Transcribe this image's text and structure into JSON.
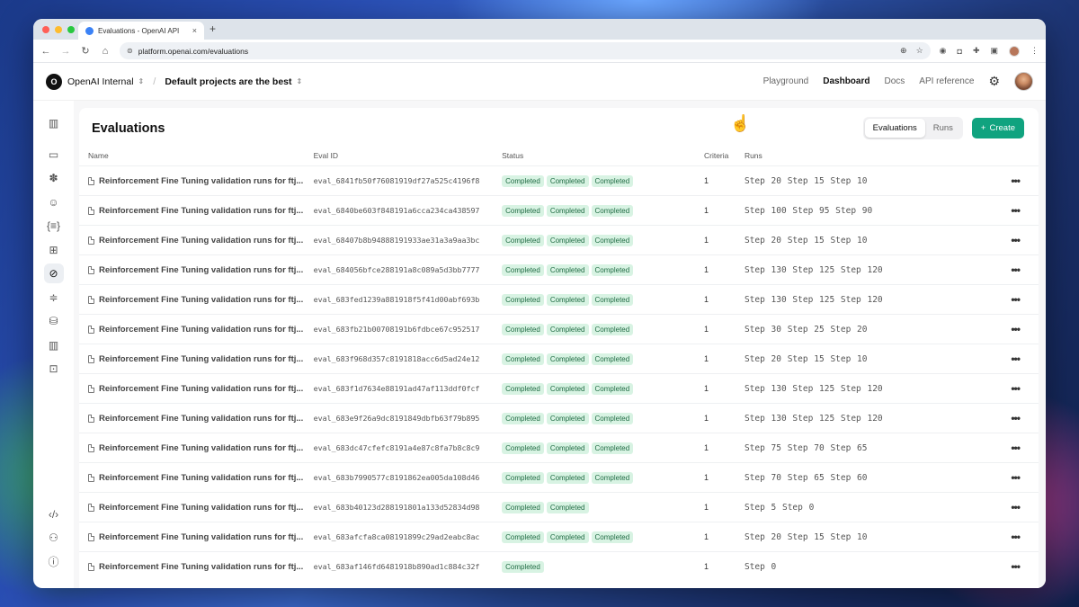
{
  "browser": {
    "tab_title": "Evaluations - OpenAI API",
    "url": "platform.openai.com/evaluations",
    "new_tab": "+",
    "close_tab": "×"
  },
  "header": {
    "org_initial": "O",
    "org_name": "OpenAI Internal",
    "project_name": "Default projects are the best",
    "nav": [
      "Playground",
      "Dashboard",
      "Docs",
      "API reference"
    ],
    "active_nav": "Dashboard"
  },
  "page": {
    "title": "Evaluations",
    "toggle": [
      "Evaluations",
      "Runs"
    ],
    "create_label": "Create"
  },
  "table": {
    "columns": [
      "Name",
      "Eval ID",
      "Status",
      "Criteria",
      "Runs"
    ],
    "rows": [
      {
        "name": "Reinforcement Fine Tuning validation runs for ftj...",
        "id": "eval_6841fb50f76081919df27a525c4196f8",
        "status": [
          "Completed",
          "Completed",
          "Completed"
        ],
        "criteria": "1",
        "runs": "Step 20 Step 15 Step 10"
      },
      {
        "name": "Reinforcement Fine Tuning validation runs for ftj...",
        "id": "eval_6840be603f848191a6cca234ca438597",
        "status": [
          "Completed",
          "Completed",
          "Completed"
        ],
        "criteria": "1",
        "runs": "Step 100 Step 95 Step 90"
      },
      {
        "name": "Reinforcement Fine Tuning validation runs for ftj...",
        "id": "eval_68407b8b94888191933ae31a3a9aa3bc",
        "status": [
          "Completed",
          "Completed",
          "Completed"
        ],
        "criteria": "1",
        "runs": "Step 20 Step 15 Step 10"
      },
      {
        "name": "Reinforcement Fine Tuning validation runs for ftj...",
        "id": "eval_684056bfce288191a8c089a5d3bb7777",
        "status": [
          "Completed",
          "Completed",
          "Completed"
        ],
        "criteria": "1",
        "runs": "Step 130 Step 125 Step 120"
      },
      {
        "name": "Reinforcement Fine Tuning validation runs for ftj...",
        "id": "eval_683fed1239a881918f5f41d00abf693b",
        "status": [
          "Completed",
          "Completed",
          "Completed"
        ],
        "criteria": "1",
        "runs": "Step 130 Step 125 Step 120"
      },
      {
        "name": "Reinforcement Fine Tuning validation runs for ftj...",
        "id": "eval_683fb21b00708191b6fdbce67c952517",
        "status": [
          "Completed",
          "Completed",
          "Completed"
        ],
        "criteria": "1",
        "runs": "Step 30 Step 25 Step 20"
      },
      {
        "name": "Reinforcement Fine Tuning validation runs for ftj...",
        "id": "eval_683f968d357c8191818acc6d5ad24e12",
        "status": [
          "Completed",
          "Completed",
          "Completed"
        ],
        "criteria": "1",
        "runs": "Step 20 Step 15 Step 10"
      },
      {
        "name": "Reinforcement Fine Tuning validation runs for ftj...",
        "id": "eval_683f1d7634e88191ad47af113ddf0fcf",
        "status": [
          "Completed",
          "Completed",
          "Completed"
        ],
        "criteria": "1",
        "runs": "Step 130 Step 125 Step 120"
      },
      {
        "name": "Reinforcement Fine Tuning validation runs for ftj...",
        "id": "eval_683e9f26a9dc8191849dbfb63f79b895",
        "status": [
          "Completed",
          "Completed",
          "Completed"
        ],
        "criteria": "1",
        "runs": "Step 130 Step 125 Step 120"
      },
      {
        "name": "Reinforcement Fine Tuning validation runs for ftj...",
        "id": "eval_683dc47cfefc8191a4e87c8fa7b8c8c9",
        "status": [
          "Completed",
          "Completed",
          "Completed"
        ],
        "criteria": "1",
        "runs": "Step 75 Step 70 Step 65"
      },
      {
        "name": "Reinforcement Fine Tuning validation runs for ftj...",
        "id": "eval_683b7990577c8191862ea005da108d46",
        "status": [
          "Completed",
          "Completed",
          "Completed"
        ],
        "criteria": "1",
        "runs": "Step 70 Step 65 Step 60"
      },
      {
        "name": "Reinforcement Fine Tuning validation runs for ftj...",
        "id": "eval_683b40123d288191801a133d52834d98",
        "status": [
          "Completed",
          "Completed"
        ],
        "criteria": "1",
        "runs": "Step 5 Step 0"
      },
      {
        "name": "Reinforcement Fine Tuning validation runs for ftj...",
        "id": "eval_683afcfa8ca08191899c29ad2eabc8ac",
        "status": [
          "Completed",
          "Completed",
          "Completed"
        ],
        "criteria": "1",
        "runs": "Step 20 Step 15 Step 10"
      },
      {
        "name": "Reinforcement Fine Tuning validation runs for ftj...",
        "id": "eval_683af146fd6481918b890ad1c884c32f",
        "status": [
          "Completed"
        ],
        "criteria": "1",
        "runs": "Step 0"
      }
    ]
  },
  "colors": {
    "accent": "#10a37f",
    "badge_bg": "#d8f3e3",
    "badge_text": "#1f6b43"
  },
  "icons": {
    "sidebar": [
      "sidebar-toggle-icon",
      "chat-icon",
      "sparkle-icon",
      "assistant-icon",
      "brackets-icon",
      "grid-icon",
      "compass-icon",
      "sliders-icon",
      "database-icon",
      "bar-chart-icon",
      "lock-icon"
    ],
    "sidebar_bottom": [
      "code-icon",
      "users-icon",
      "help-icon"
    ]
  }
}
